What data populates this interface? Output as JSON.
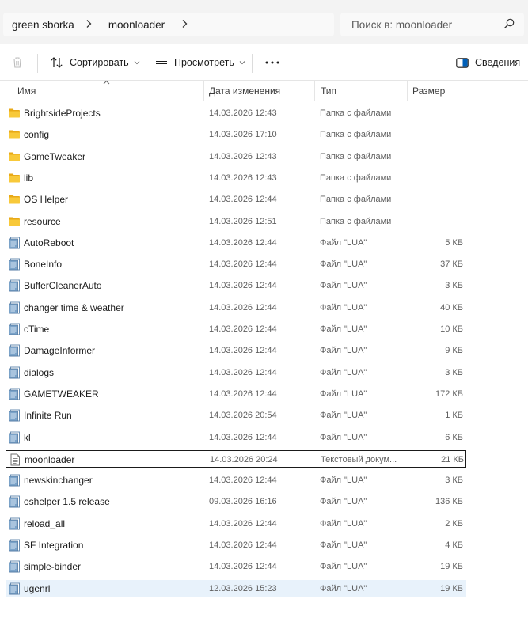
{
  "address": {
    "crumbs": [
      "green sborka",
      "moonloader"
    ],
    "separator": ">"
  },
  "search": {
    "placeholder": "Поиск в: moonloader"
  },
  "toolbar": {
    "sort_label": "Сортировать",
    "view_label": "Просмотреть",
    "more_label": "...",
    "details_label": "Сведения"
  },
  "columns": {
    "name": "Имя",
    "date": "Дата изменения",
    "type": "Тип",
    "size": "Размер"
  },
  "files": [
    {
      "name": "BrightsideProjects",
      "date": "14.03.2026 12:43",
      "type": "Папка с файлами",
      "size": "",
      "icon": "folder-icon"
    },
    {
      "name": "config",
      "date": "14.03.2026 17:10",
      "type": "Папка с файлами",
      "size": "",
      "icon": "folder-icon"
    },
    {
      "name": "GameTweaker",
      "date": "14.03.2026 12:43",
      "type": "Папка с файлами",
      "size": "",
      "icon": "folder-icon"
    },
    {
      "name": "lib",
      "date": "14.03.2026 12:43",
      "type": "Папка с файлами",
      "size": "",
      "icon": "folder-icon"
    },
    {
      "name": "OS Helper",
      "date": "14.03.2026 12:44",
      "type": "Папка с файлами",
      "size": "",
      "icon": "folder-icon"
    },
    {
      "name": "resource",
      "date": "14.03.2026 12:51",
      "type": "Папка с файлами",
      "size": "",
      "icon": "folder-icon"
    },
    {
      "name": "AutoReboot",
      "date": "14.03.2026 12:44",
      "type": "Файл \"LUA\"",
      "size": "5 КБ",
      "icon": "lua-file-icon"
    },
    {
      "name": "BoneInfo",
      "date": "14.03.2026 12:44",
      "type": "Файл \"LUA\"",
      "size": "37 КБ",
      "icon": "lua-file-icon"
    },
    {
      "name": "BufferCleanerAuto",
      "date": "14.03.2026 12:44",
      "type": "Файл \"LUA\"",
      "size": "3 КБ",
      "icon": "lua-file-icon"
    },
    {
      "name": "changer time & weather",
      "date": "14.03.2026 12:44",
      "type": "Файл \"LUA\"",
      "size": "40 КБ",
      "icon": "lua-file-icon"
    },
    {
      "name": "cTime",
      "date": "14.03.2026 12:44",
      "type": "Файл \"LUA\"",
      "size": "10 КБ",
      "icon": "lua-file-icon"
    },
    {
      "name": "DamageInformer",
      "date": "14.03.2026 12:44",
      "type": "Файл \"LUA\"",
      "size": "9 КБ",
      "icon": "lua-file-icon"
    },
    {
      "name": "dialogs",
      "date": "14.03.2026 12:44",
      "type": "Файл \"LUA\"",
      "size": "3 КБ",
      "icon": "lua-file-icon"
    },
    {
      "name": "GAMETWEAKER",
      "date": "14.03.2026 12:44",
      "type": "Файл \"LUA\"",
      "size": "172 КБ",
      "icon": "lua-file-icon"
    },
    {
      "name": "Infinite Run",
      "date": "14.03.2026 20:54",
      "type": "Файл \"LUA\"",
      "size": "1 КБ",
      "icon": "lua-file-icon"
    },
    {
      "name": "kl",
      "date": "14.03.2026 12:44",
      "type": "Файл \"LUA\"",
      "size": "6 КБ",
      "icon": "lua-file-icon"
    },
    {
      "name": "moonloader",
      "date": "14.03.2026 20:24",
      "type": "Текстовый докум...",
      "size": "21 КБ",
      "icon": "text-file-icon",
      "state": "selected"
    },
    {
      "name": "newskinchanger",
      "date": "14.03.2026 12:44",
      "type": "Файл \"LUA\"",
      "size": "3 КБ",
      "icon": "lua-file-icon"
    },
    {
      "name": "oshelper 1.5 release",
      "date": "09.03.2026 16:16",
      "type": "Файл \"LUA\"",
      "size": "136 КБ",
      "icon": "lua-file-icon"
    },
    {
      "name": "reload_all",
      "date": "14.03.2026 12:44",
      "type": "Файл \"LUA\"",
      "size": "2 КБ",
      "icon": "lua-file-icon"
    },
    {
      "name": "SF Integration",
      "date": "14.03.2026 12:44",
      "type": "Файл \"LUA\"",
      "size": "4 КБ",
      "icon": "lua-file-icon"
    },
    {
      "name": "simple-binder",
      "date": "14.03.2026 12:44",
      "type": "Файл \"LUA\"",
      "size": "19 КБ",
      "icon": "lua-file-icon"
    },
    {
      "name": "ugenrl",
      "date": "12.03.2026 15:23",
      "type": "Файл \"LUA\"",
      "size": "19 КБ",
      "icon": "lua-file-icon",
      "state": "hover"
    }
  ],
  "colors": {
    "folder": "#f8c93a",
    "folder_dark": "#e8a917",
    "lua_file": "#7ba3c9",
    "accent": "#005fb8",
    "hover_row": "#e8f2fb"
  }
}
